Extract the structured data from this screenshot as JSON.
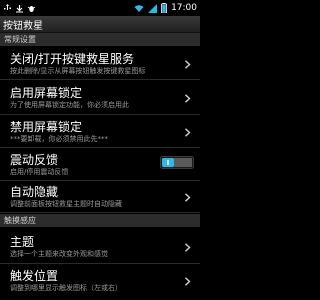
{
  "status_bar": {
    "time": "17:00"
  },
  "app_bar": {
    "title": "按钮救星"
  },
  "sections": [
    {
      "header": "常规设置"
    },
    {
      "header": "触摸感应"
    }
  ],
  "preferences": [
    {
      "title": "关闭/打开按键救星服务",
      "summary": "按此删除/显示从屏幕按钮触发按键救星图标"
    },
    {
      "title": "启用屏幕锁定",
      "summary": "为了使用屏幕锁定功能，你必须启用此"
    },
    {
      "title": "禁用屏幕锁定",
      "summary": "***要卸载，你必须禁用此先***"
    },
    {
      "title": "震动反馈",
      "summary": "启用/停用震动反馈",
      "toggle_on": true
    },
    {
      "title": "自动隐藏",
      "summary": "调整前面板按钮救星主题时自动隐藏"
    },
    {
      "title": "主题",
      "summary": "选择一个主题来改变外观和感觉"
    },
    {
      "title": "触发位置",
      "summary": "调整到哪里显示触发图标（左或右）"
    }
  ],
  "colors": {
    "accent": "#33b5e5",
    "background": "#000000",
    "section": "#2c2c2c"
  }
}
